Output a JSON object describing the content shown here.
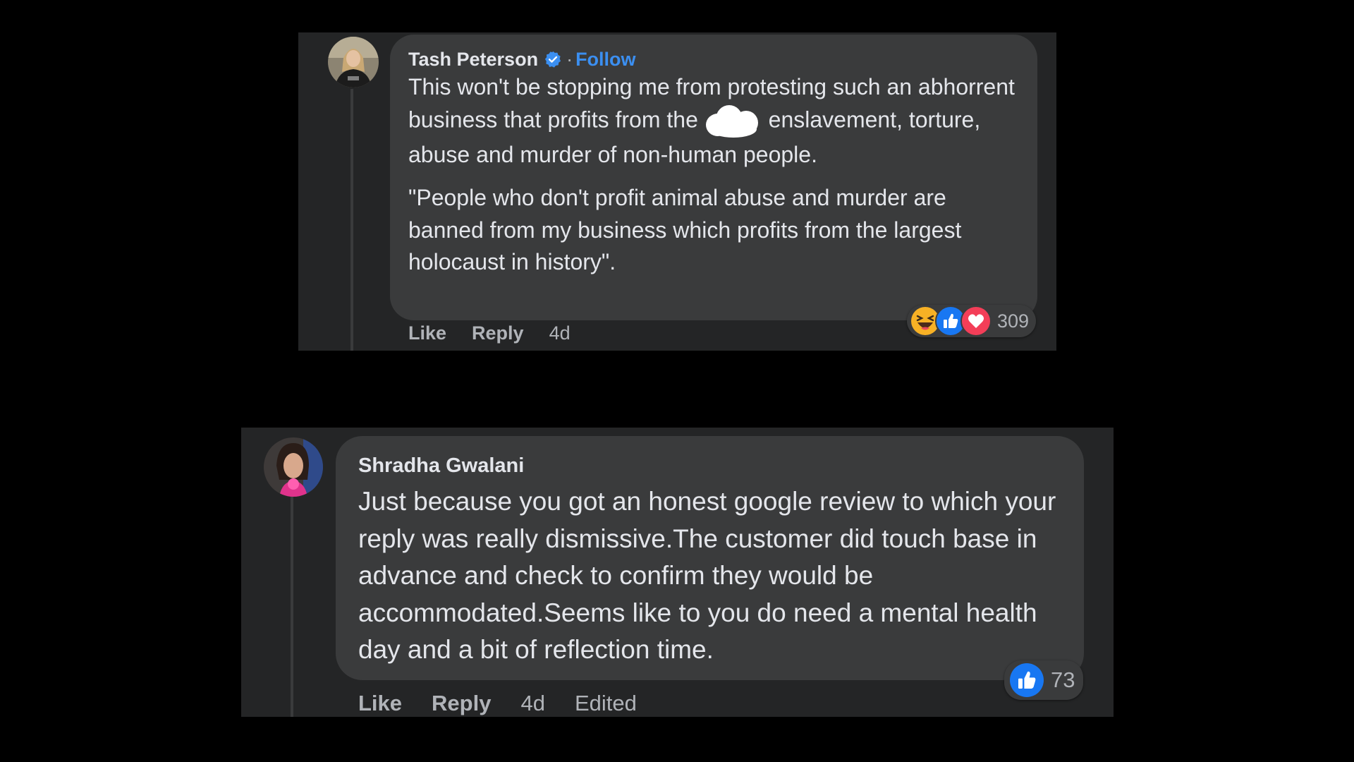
{
  "comments": [
    {
      "author": "Tash Peterson",
      "verified": true,
      "separator": "·",
      "follow_label": "Follow",
      "paragraphs": [
        {
          "before": "This won't be stopping me from protesting such an abhorrent business that profits from the ",
          "after": " enslavement, torture, abuse and murder of non-human people."
        },
        {
          "text": "\"People who don't profit animal abuse and murder are banned from my business which profits from the largest holocaust in history\"."
        }
      ],
      "actions": {
        "like": "Like",
        "reply": "Reply",
        "age": "4d"
      },
      "reactions": {
        "types": [
          "haha",
          "like",
          "love"
        ],
        "count": "309"
      }
    },
    {
      "author": "Shradha Gwalani",
      "verified": false,
      "text": "Just because you got an honest google review to which your reply was really dismissive.The customer did touch base in advance and check to confirm they would be accommodated.Seems like to you do need a mental health day and a bit of reflection time.",
      "actions": {
        "like": "Like",
        "reply": "Reply",
        "age": "4d",
        "edited": "Edited"
      },
      "reactions": {
        "types": [
          "like"
        ],
        "count": "73"
      }
    }
  ],
  "colors": {
    "page_background": "#000000",
    "panel_background": "#242526",
    "bubble_background": "#3a3b3c",
    "primary_text": "#e4e6eb",
    "secondary_text": "#b0b3b8",
    "link_blue": "#3b8ff1",
    "like_blue": "#1877f2",
    "love_red": "#f33e58",
    "haha_yellow": "#f7b125"
  }
}
